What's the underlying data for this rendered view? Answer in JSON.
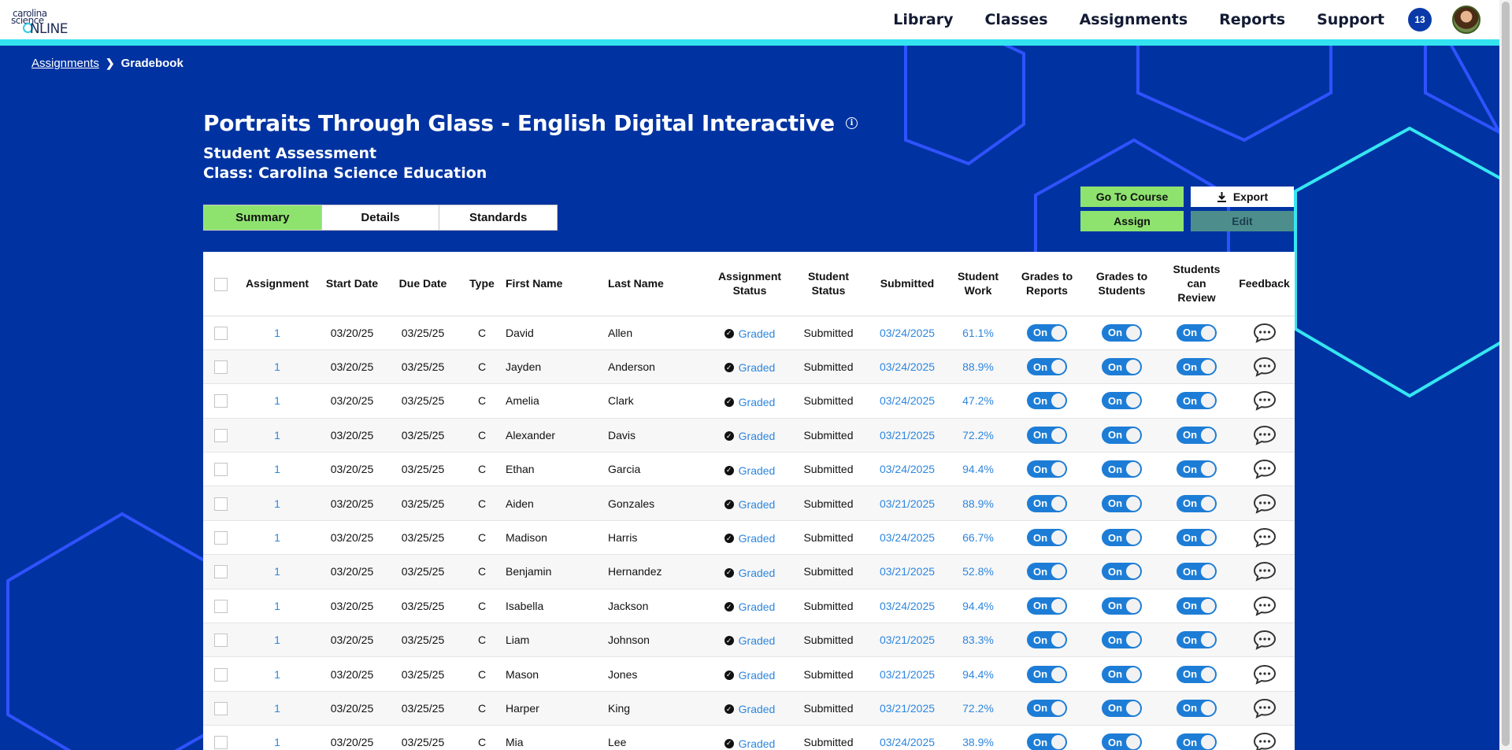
{
  "header": {
    "logo": {
      "line1": "carolina",
      "line2": "science",
      "line3": "NLINE"
    },
    "nav": [
      "Library",
      "Classes",
      "Assignments",
      "Reports",
      "Support"
    ],
    "notification_count": "13"
  },
  "breadcrumb": {
    "parent": "Assignments",
    "current": "Gradebook"
  },
  "page": {
    "title": "Portraits Through Glass - English Digital Interactive",
    "subtitle": "Student Assessment",
    "class_line": "Class: Carolina Science Education"
  },
  "tabs": [
    "Summary",
    "Details",
    "Standards"
  ],
  "actions": {
    "go_to_course": "Go To Course",
    "export": "Export",
    "assign": "Assign",
    "edit": "Edit"
  },
  "table": {
    "headers": {
      "assignment": "Assignment",
      "start_date": "Start Date",
      "due_date": "Due Date",
      "type": "Type",
      "first_name": "First Name",
      "last_name": "Last Name",
      "assignment_status_1": "Assignment",
      "assignment_status_2": "Status",
      "student_status_1": "Student",
      "student_status_2": "Status",
      "submitted": "Submitted",
      "student_work_1": "Student",
      "student_work_2": "Work",
      "grades_reports_1": "Grades to",
      "grades_reports_2": "Reports",
      "grades_students_1": "Grades to",
      "grades_students_2": "Students",
      "review_1": "Students",
      "review_2": "can",
      "review_3": "Review",
      "feedback": "Feedback"
    },
    "toggle_label": "On",
    "rows": [
      {
        "assignment": "1",
        "start": "03/20/25",
        "due": "03/25/25",
        "type": "C",
        "first": "David",
        "last": "Allen",
        "astatus": "Graded",
        "sstatus": "Submitted",
        "submitted": "03/24/2025",
        "work": "61.1%"
      },
      {
        "assignment": "1",
        "start": "03/20/25",
        "due": "03/25/25",
        "type": "C",
        "first": "Jayden",
        "last": "Anderson",
        "astatus": "Graded",
        "sstatus": "Submitted",
        "submitted": "03/24/2025",
        "work": "88.9%"
      },
      {
        "assignment": "1",
        "start": "03/20/25",
        "due": "03/25/25",
        "type": "C",
        "first": "Amelia",
        "last": "Clark",
        "astatus": "Graded",
        "sstatus": "Submitted",
        "submitted": "03/24/2025",
        "work": "47.2%"
      },
      {
        "assignment": "1",
        "start": "03/20/25",
        "due": "03/25/25",
        "type": "C",
        "first": "Alexander",
        "last": "Davis",
        "astatus": "Graded",
        "sstatus": "Submitted",
        "submitted": "03/21/2025",
        "work": "72.2%"
      },
      {
        "assignment": "1",
        "start": "03/20/25",
        "due": "03/25/25",
        "type": "C",
        "first": "Ethan",
        "last": "Garcia",
        "astatus": "Graded",
        "sstatus": "Submitted",
        "submitted": "03/24/2025",
        "work": "94.4%"
      },
      {
        "assignment": "1",
        "start": "03/20/25",
        "due": "03/25/25",
        "type": "C",
        "first": "Aiden",
        "last": "Gonzales",
        "astatus": "Graded",
        "sstatus": "Submitted",
        "submitted": "03/21/2025",
        "work": "88.9%"
      },
      {
        "assignment": "1",
        "start": "03/20/25",
        "due": "03/25/25",
        "type": "C",
        "first": "Madison",
        "last": "Harris",
        "astatus": "Graded",
        "sstatus": "Submitted",
        "submitted": "03/24/2025",
        "work": "66.7%"
      },
      {
        "assignment": "1",
        "start": "03/20/25",
        "due": "03/25/25",
        "type": "C",
        "first": "Benjamin",
        "last": "Hernandez",
        "astatus": "Graded",
        "sstatus": "Submitted",
        "submitted": "03/21/2025",
        "work": "52.8%"
      },
      {
        "assignment": "1",
        "start": "03/20/25",
        "due": "03/25/25",
        "type": "C",
        "first": "Isabella",
        "last": "Jackson",
        "astatus": "Graded",
        "sstatus": "Submitted",
        "submitted": "03/24/2025",
        "work": "94.4%"
      },
      {
        "assignment": "1",
        "start": "03/20/25",
        "due": "03/25/25",
        "type": "C",
        "first": "Liam",
        "last": "Johnson",
        "astatus": "Graded",
        "sstatus": "Submitted",
        "submitted": "03/21/2025",
        "work": "83.3%"
      },
      {
        "assignment": "1",
        "start": "03/20/25",
        "due": "03/25/25",
        "type": "C",
        "first": "Mason",
        "last": "Jones",
        "astatus": "Graded",
        "sstatus": "Submitted",
        "submitted": "03/21/2025",
        "work": "94.4%"
      },
      {
        "assignment": "1",
        "start": "03/20/25",
        "due": "03/25/25",
        "type": "C",
        "first": "Harper",
        "last": "King",
        "astatus": "Graded",
        "sstatus": "Submitted",
        "submitted": "03/21/2025",
        "work": "72.2%"
      },
      {
        "assignment": "1",
        "start": "03/20/25",
        "due": "03/25/25",
        "type": "C",
        "first": "Mia",
        "last": "Lee",
        "astatus": "Graded",
        "sstatus": "Submitted",
        "submitted": "03/24/2025",
        "work": "38.9%"
      }
    ]
  },
  "colors": {
    "background": "#0033a1",
    "accent": "#33e3f0",
    "green": "#8ee36f",
    "toggle": "#1d7dd6",
    "link": "#2e86de"
  },
  "icons": [
    "info-icon",
    "chevron-right-icon",
    "download-icon",
    "check-circle-icon",
    "chat-bubble-icon"
  ]
}
